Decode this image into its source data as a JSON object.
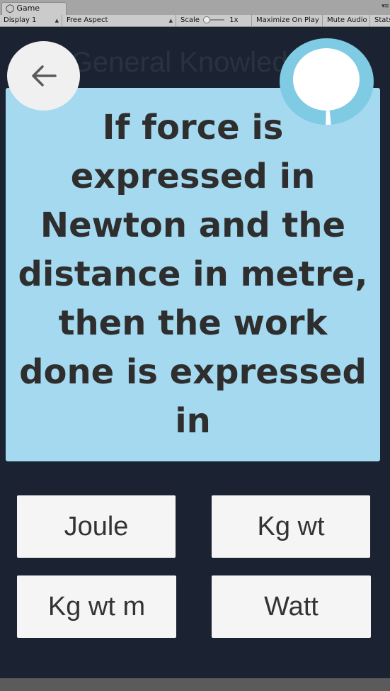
{
  "editor": {
    "tab_label": "Game",
    "display": "Display 1",
    "aspect": "Free Aspect",
    "scale_label": "Scale",
    "scale_value": "1x",
    "maximize": "Maximize On Play",
    "mute": "Mute Audio",
    "stats": "Stats"
  },
  "quiz": {
    "category_title": "General Knowledge",
    "question": "If force is expressed in Newton and the distance in metre, then the work done is expressed in",
    "answers": [
      "Joule",
      "Kg wt",
      "Kg wt m",
      "Watt"
    ],
    "timer_progress": 0.97
  },
  "colors": {
    "background": "#1b2332",
    "card": "#a5d9f0",
    "timer_ring": "#7ecbe3",
    "button": "#f5f5f5"
  }
}
